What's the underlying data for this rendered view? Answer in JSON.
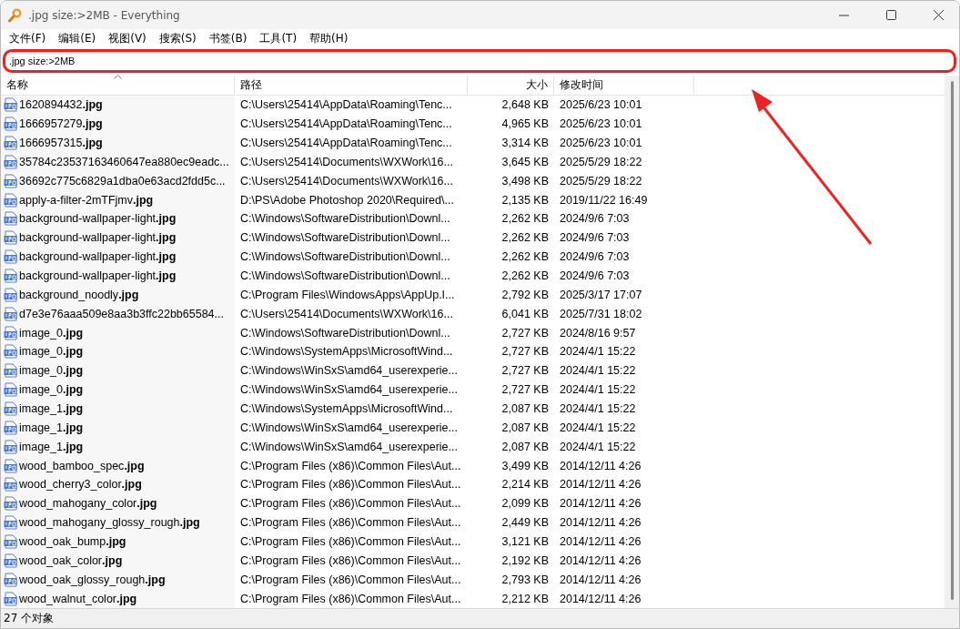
{
  "window": {
    "title": ".jpg size:>2MB - Everything"
  },
  "menu": [
    "文件(F)",
    "编辑(E)",
    "视图(V)",
    "搜索(S)",
    "书签(B)",
    "工具(T)",
    "帮助(H)"
  ],
  "search": {
    "value": ".jpg size:>2MB"
  },
  "table": {
    "columns": [
      {
        "label": "名称",
        "sorted": true
      },
      {
        "label": "路径",
        "sorted": false
      },
      {
        "label": "大小",
        "sorted": false
      },
      {
        "label": "修改时间",
        "sorted": false
      }
    ],
    "rows": [
      [
        "1620894432**.jpg**",
        "C:\\Users\\25414\\AppData\\Roaming\\Tenc...",
        "2,648 KB",
        "2025/6/23 10:01"
      ],
      [
        "1666957279**.jpg**",
        "C:\\Users\\25414\\AppData\\Roaming\\Tenc...",
        "4,965 KB",
        "2025/6/23 10:01"
      ],
      [
        "1666957315**.jpg**",
        "C:\\Users\\25414\\AppData\\Roaming\\Tenc...",
        "3,314 KB",
        "2025/6/23 10:01"
      ],
      [
        "35784c23537163460647ea880ec9eadc...",
        "C:\\Users\\25414\\Documents\\WXWork\\16...",
        "3,645 KB",
        "2025/5/29 18:22"
      ],
      [
        "36692c775c6829a1dba0e63acd2fdd5c...",
        "C:\\Users\\25414\\Documents\\WXWork\\16...",
        "3,498 KB",
        "2025/5/29 18:22"
      ],
      [
        "apply-a-filter-2mTFjmv**.jpg**",
        "D:\\PS\\Adobe Photoshop 2020\\Required\\...",
        "2,135 KB",
        "2019/11/22 16:49"
      ],
      [
        "background-wallpaper-light**.jpg**",
        "C:\\Windows\\SoftwareDistribution\\Downl...",
        "2,262 KB",
        "2024/9/6 7:03"
      ],
      [
        "background-wallpaper-light**.jpg**",
        "C:\\Windows\\SoftwareDistribution\\Downl...",
        "2,262 KB",
        "2024/9/6 7:03"
      ],
      [
        "background-wallpaper-light**.jpg**",
        "C:\\Windows\\SoftwareDistribution\\Downl...",
        "2,262 KB",
        "2024/9/6 7:03"
      ],
      [
        "background-wallpaper-light**.jpg**",
        "C:\\Windows\\SoftwareDistribution\\Downl...",
        "2,262 KB",
        "2024/9/6 7:03"
      ],
      [
        "background_noodly**.jpg**",
        "C:\\Program Files\\WindowsApps\\AppUp.I...",
        "2,792 KB",
        "2025/3/17 17:07"
      ],
      [
        "d7e3e76aaa509e8aa3b3ffc22bb65584...",
        "C:\\Users\\25414\\Documents\\WXWork\\16...",
        "6,041 KB",
        "2025/7/31 18:02"
      ],
      [
        "image_0**.jpg**",
        "C:\\Windows\\SoftwareDistribution\\Downl...",
        "2,727 KB",
        "2024/8/16 9:57"
      ],
      [
        "image_0**.jpg**",
        "C:\\Windows\\SystemApps\\MicrosoftWind...",
        "2,727 KB",
        "2024/4/1 15:22"
      ],
      [
        "image_0**.jpg**",
        "C:\\Windows\\WinSxS\\amd64_userexperie...",
        "2,727 KB",
        "2024/4/1 15:22"
      ],
      [
        "image_0**.jpg**",
        "C:\\Windows\\WinSxS\\amd64_userexperie...",
        "2,727 KB",
        "2024/4/1 15:22"
      ],
      [
        "image_1**.jpg**",
        "C:\\Windows\\SystemApps\\MicrosoftWind...",
        "2,087 KB",
        "2024/4/1 15:22"
      ],
      [
        "image_1**.jpg**",
        "C:\\Windows\\WinSxS\\amd64_userexperie...",
        "2,087 KB",
        "2024/4/1 15:22"
      ],
      [
        "image_1**.jpg**",
        "C:\\Windows\\WinSxS\\amd64_userexperie...",
        "2,087 KB",
        "2024/4/1 15:22"
      ],
      [
        "wood_bamboo_spec**.jpg**",
        "C:\\Program Files (x86)\\Common Files\\Aut...",
        "3,499 KB",
        "2014/12/11 4:26"
      ],
      [
        "wood_cherry3_color**.jpg**",
        "C:\\Program Files (x86)\\Common Files\\Aut...",
        "2,214 KB",
        "2014/12/11 4:26"
      ],
      [
        "wood_mahogany_color**.jpg**",
        "C:\\Program Files (x86)\\Common Files\\Aut...",
        "2,099 KB",
        "2014/12/11 4:26"
      ],
      [
        "wood_mahogany_glossy_rough**.jpg**",
        "C:\\Program Files (x86)\\Common Files\\Aut...",
        "2,449 KB",
        "2014/12/11 4:26"
      ],
      [
        "wood_oak_bump**.jpg**",
        "C:\\Program Files (x86)\\Common Files\\Aut...",
        "3,121 KB",
        "2014/12/11 4:26"
      ],
      [
        "wood_oak_color**.jpg**",
        "C:\\Program Files (x86)\\Common Files\\Aut...",
        "2,192 KB",
        "2014/12/11 4:26"
      ],
      [
        "wood_oak_glossy_rough**.jpg**",
        "C:\\Program Files (x86)\\Common Files\\Aut...",
        "2,793 KB",
        "2014/12/11 4:26"
      ],
      [
        "wood_walnut_color**.jpg**",
        "C:\\Program Files (x86)\\Common Files\\Aut...",
        "2,212 KB",
        "2014/12/11 4:26"
      ]
    ]
  },
  "status_bar": "27 个对象"
}
